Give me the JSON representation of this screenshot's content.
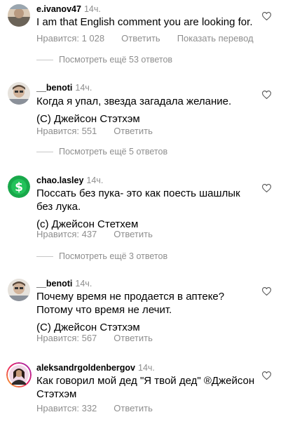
{
  "colors": {
    "secondary_text": "#8e8e8e",
    "reply_line": "#c7c7c7",
    "primary_text": "#000000"
  },
  "comments": [
    {
      "username": "e.ivanov47",
      "time": "14ч.",
      "lines": [
        "I am that English comment you are looking for."
      ],
      "likes": "Нравится: 1 028",
      "reply_label": "Ответить",
      "translate_label": "Показать перевод",
      "view_replies": "Посмотреть ещё 53 ответов",
      "avatar_icon": "avatar-photo-icon"
    },
    {
      "username": "__benoti",
      "time": "14ч.",
      "lines": [
        "Когда я упал, звезда загадала желание.",
        "(С) Джейсон Стэтхэм"
      ],
      "likes": "Нравится: 551",
      "reply_label": "Ответить",
      "view_replies": "Посмотреть ещё 5 ответов",
      "avatar_icon": "avatar-photo-icon"
    },
    {
      "username": "chao.lasley",
      "time": "14ч.",
      "lines": [
        "Поссать без пука- это как поесть шашлык без лука.",
        "(с) Джейсон Стетхем"
      ],
      "likes": "Нравится: 437",
      "reply_label": "Ответить",
      "view_replies": "Посмотреть ещё 3 ответов",
      "avatar_icon": "dollar-sign-icon"
    },
    {
      "username": "__benoti",
      "time": "14ч.",
      "lines": [
        "Почему время не продается в аптеке? Потому что время не лечит.",
        "(С) Джейсон Стэтхэм"
      ],
      "likes": "Нравится: 567",
      "reply_label": "Ответить",
      "avatar_icon": "avatar-photo-icon"
    },
    {
      "username": "aleksandrgoldenbergov",
      "time": "14ч.",
      "lines": [
        "Как говорил мой дед \"Я твой дед\" ®Джейсон Стэтхэм"
      ],
      "likes": "Нравится: 332",
      "reply_label": "Ответить",
      "avatar_icon": "story-ring-avatar-icon"
    }
  ]
}
